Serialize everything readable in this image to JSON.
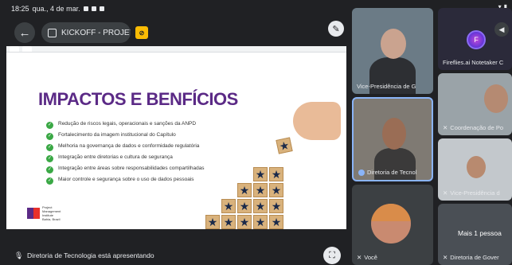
{
  "status_bar": {
    "time": "18:25",
    "date": "qua., 4 de mar."
  },
  "meeting": {
    "title": "KICKOFF - PROJETO"
  },
  "slide": {
    "title": "IMPACTOS E BENFÍCIOS",
    "bullets": [
      "Redução de riscos legais, operacionais e sanções da ANPD",
      "Fortalecimento da imagem institucional do Capítulo",
      "Melhoria na governança de dados e conformidade regulatória",
      "Integração entre diretorias e cultura de segurança",
      "Integração entre áreas sobre responsabilidades compartilhadas",
      "Maior controle e segurança sobre o uso de dados pessoais"
    ],
    "logo_text": [
      "Project",
      "Management",
      "Institute",
      "Bahia, Brazil"
    ],
    "star_glyph": "★"
  },
  "presenting": {
    "text": "Diretoria de Tecnologia está apresentando"
  },
  "participants": [
    {
      "name": "Vice-Presidência de G"
    },
    {
      "name": "Fireflies.ai Notetaker C"
    },
    {
      "name": "Diretoria de Tecnol"
    },
    {
      "name": "Coordenação de Po"
    },
    {
      "name": "Vice-Presidência d"
    },
    {
      "name": "Você"
    },
    {
      "name": "Diretoria de Gover",
      "overlay": "Mais 1 pessoa"
    }
  ],
  "colors": {
    "background": "#202124",
    "slide_title": "#5b2a86",
    "check": "#3aa845",
    "active_border": "#8ab4f8"
  }
}
